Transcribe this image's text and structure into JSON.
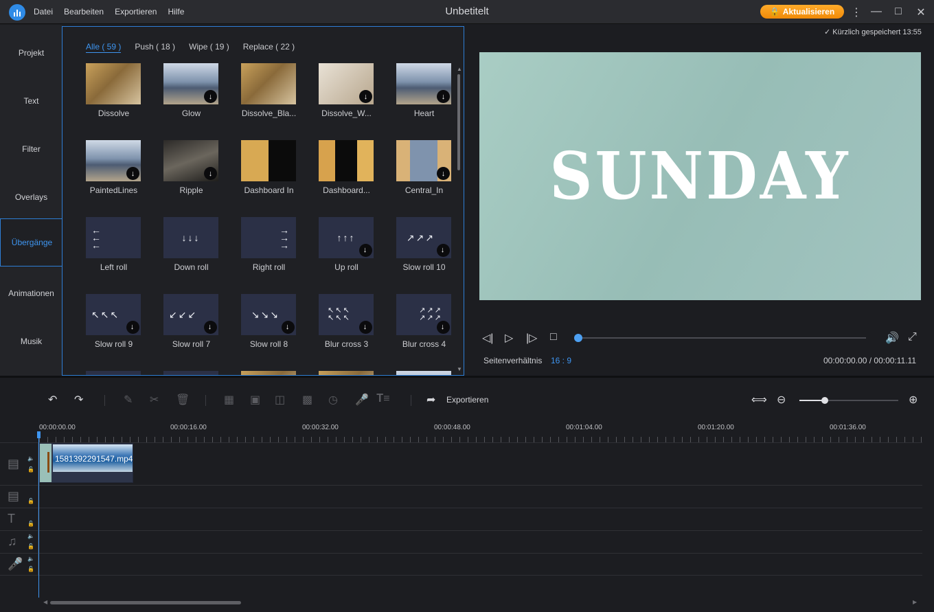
{
  "titlebar": {
    "menu": [
      "Datei",
      "Bearbeiten",
      "Exportieren",
      "Hilfe"
    ],
    "title": "Unbetitelt",
    "upgrade_label": "Aktualisieren",
    "upgrade_color": "#f59a12"
  },
  "sidebar": {
    "items": [
      {
        "label": "Projekt"
      },
      {
        "label": "Text"
      },
      {
        "label": "Filter"
      },
      {
        "label": "Overlays"
      },
      {
        "label": "Übergänge",
        "active": true
      },
      {
        "label": "Animationen"
      },
      {
        "label": "Musik"
      }
    ]
  },
  "transitions": {
    "tabs": [
      "Alle ( 59 )",
      "Push ( 18 )",
      "Wipe ( 19 )",
      "Replace ( 22 )"
    ],
    "active_tab": "Alle ( 59 )",
    "items": [
      {
        "label": "Dissolve"
      },
      {
        "label": "Glow"
      },
      {
        "label": "Dissolve_Bla..."
      },
      {
        "label": "Dissolve_W..."
      },
      {
        "label": "Heart"
      },
      {
        "label": "PaintedLines"
      },
      {
        "label": "Ripple"
      },
      {
        "label": "Dashboard In"
      },
      {
        "label": "Dashboard..."
      },
      {
        "label": "Central_In"
      },
      {
        "label": "Left roll"
      },
      {
        "label": "Down roll"
      },
      {
        "label": "Right roll"
      },
      {
        "label": "Up roll"
      },
      {
        "label": "Slow roll 10"
      },
      {
        "label": "Slow roll 9"
      },
      {
        "label": "Slow roll 7"
      },
      {
        "label": "Slow roll 8"
      },
      {
        "label": "Blur cross 3"
      },
      {
        "label": "Blur cross 4"
      }
    ]
  },
  "preview": {
    "saved_status": "Kürzlich gespeichert 13:55",
    "text": "SUNDAY",
    "background_color": "#a3c8c0",
    "aspect_label": "Seitenverhältnis",
    "aspect_value": "16 : 9",
    "timecode": "00:00:00.00 / 00:00:11.11",
    "progress": 0
  },
  "timeline": {
    "export_label": "Exportieren",
    "ruler": [
      "00:00:00.00",
      "00:00:16.00",
      "00:00:32.00",
      "00:00:48.00",
      "00:01:04.00",
      "00:01:20.00",
      "00:01:36.00"
    ],
    "clip_name": "1581392291547.mp4",
    "zoom_level": 0.26,
    "accent_color": "#3e95f0"
  }
}
